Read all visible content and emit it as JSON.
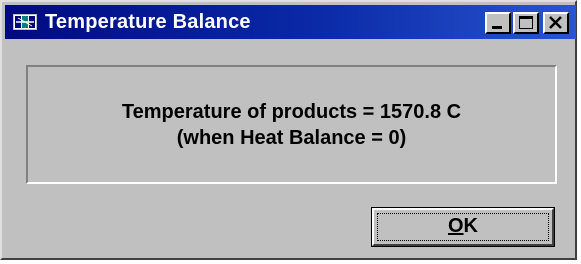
{
  "window": {
    "title": "Temperature Balance",
    "icon": "app-icon",
    "controls": [
      "minimize-icon",
      "maximize-icon",
      "close-icon"
    ]
  },
  "message": {
    "line1": "Temperature of products = 1570.8 C",
    "line2": "(when Heat Balance = 0)"
  },
  "ok_button": {
    "accelerator": "O",
    "rest": "K"
  },
  "colors": {
    "titlebar_start": "#000a80",
    "titlebar_end": "#2a55d0",
    "face": "#c0c0c0"
  }
}
